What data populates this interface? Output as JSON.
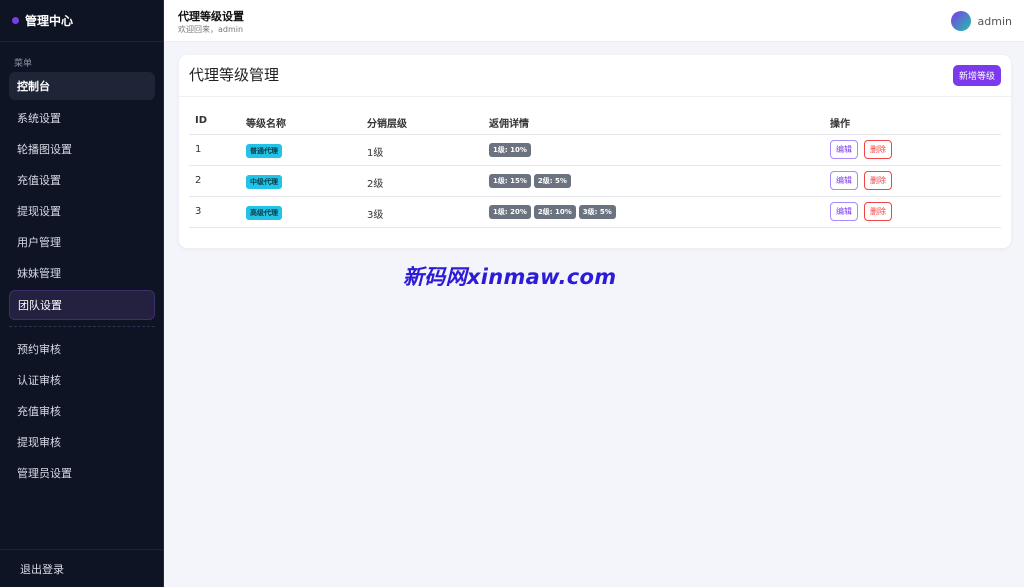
{
  "brand": {
    "title": "管理中心"
  },
  "sidebar": {
    "caption": "菜单",
    "items": [
      {
        "label": "控制台"
      },
      {
        "label": "系统设置"
      },
      {
        "label": "轮播图设置"
      },
      {
        "label": "充值设置"
      },
      {
        "label": "提现设置"
      },
      {
        "label": "用户管理"
      },
      {
        "label": "妹妹管理"
      },
      {
        "label": "团队设置"
      },
      {
        "label": "预约审核"
      },
      {
        "label": "认证审核"
      },
      {
        "label": "充值审核"
      },
      {
        "label": "提现审核"
      },
      {
        "label": "管理员设置"
      }
    ],
    "logout": "退出登录"
  },
  "header": {
    "title": "代理等级设置",
    "welcome": "欢迎回来，admin",
    "username": "admin"
  },
  "card": {
    "title": "代理等级管理",
    "add_label": "新增等级"
  },
  "table": {
    "columns": [
      "ID",
      "等级名称",
      "分销层级",
      "返佣详情",
      "操作"
    ],
    "rows": [
      {
        "id": "1",
        "name": "普通代理",
        "level": "1级",
        "details": [
          "1级: 10%"
        ]
      },
      {
        "id": "2",
        "name": "中级代理",
        "level": "2级",
        "details": [
          "1级: 15%",
          "2级: 5%"
        ]
      },
      {
        "id": "3",
        "name": "高级代理",
        "level": "3级",
        "details": [
          "1级: 20%",
          "2级: 10%",
          "3级: 5%"
        ]
      }
    ],
    "edit_label": "编辑",
    "delete_label": "删除"
  },
  "watermark": "新码网xinmaw.com",
  "colors": {
    "accent": "#7c3aed",
    "sidebar_bg": "#0f1424",
    "level_badge": "#22c3e6",
    "rate_badge": "#6b7280",
    "danger": "#ef4444"
  }
}
